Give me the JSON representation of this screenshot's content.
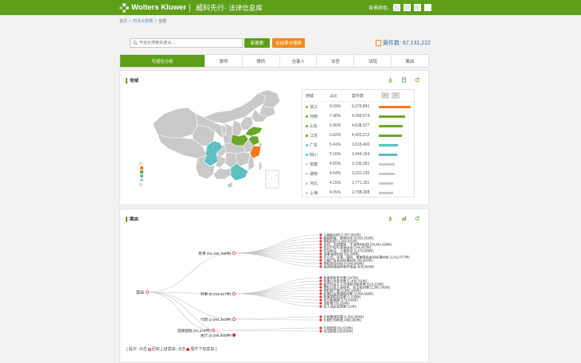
{
  "header": {
    "brand": "Wolters Kluwer",
    "brand_cn": "威科先行",
    "product": "· 法律信息库",
    "skin_label": "背景颜色:"
  },
  "breadcrumb": {
    "home": "首页",
    "section": "司法大数据",
    "current": "全部"
  },
  "search": {
    "placeholder": "可视化搜索关键词.....",
    "new_search": "新搜索",
    "search_within": "在结果中搜索"
  },
  "case_total": {
    "label": "案件数:",
    "value": "67,131,222"
  },
  "tabs": [
    {
      "label": "可视化分析",
      "active": true
    },
    {
      "label": "律师"
    },
    {
      "label": "律所"
    },
    {
      "label": "当事人"
    },
    {
      "label": "法官"
    },
    {
      "label": "法院"
    },
    {
      "label": "案由"
    }
  ],
  "region_panel": {
    "title": "地域",
    "legend": {
      "high": "高",
      "low": "低"
    },
    "colors": {
      "orange": "#f47a20",
      "green": "#6aa82b",
      "teal": "#5cc0c0",
      "grey": "#c9c9c9",
      "dark_grey": "#9a9a9a"
    },
    "table": {
      "headers": [
        "地域",
        "占比",
        "案件数"
      ],
      "prev": "<",
      "next": ">",
      "rows": [
        {
          "region": "浙江",
          "share": "9.09%",
          "count": "6,070,841",
          "ratio": 1.0,
          "color": "#f47a20"
        },
        {
          "region": "河南",
          "share": "7.48%",
          "count": "4,999,574",
          "ratio": 0.82,
          "color": "#6aa82b"
        },
        {
          "region": "山东",
          "share": "6.95%",
          "count": "4,638,977",
          "ratio": 0.76,
          "color": "#6aa82b"
        },
        {
          "region": "江苏",
          "share": "6.62%",
          "count": "4,420,212",
          "ratio": 0.73,
          "color": "#6aa82b"
        },
        {
          "region": "广东",
          "share": "5.41%",
          "count": "3,615,400",
          "ratio": 0.6,
          "color": "#5cc0c0"
        },
        {
          "region": "四川",
          "share": "5.16%",
          "count": "3,444,164",
          "ratio": 0.57,
          "color": "#5cc0c0"
        },
        {
          "region": "安徽",
          "share": "4.65%",
          "count": "3,105,391",
          "ratio": 0.51,
          "color": "#c9c9c9"
        },
        {
          "region": "湖南",
          "share": "4.64%",
          "count": "3,101,135",
          "ratio": 0.51,
          "color": "#c9c9c9"
        },
        {
          "region": "河北",
          "share": "4.15%",
          "count": "2,771,161",
          "ratio": 0.46,
          "color": "#c9c9c9"
        },
        {
          "region": "上海",
          "share": "4.05%",
          "count": "2,708,338",
          "ratio": 0.45,
          "color": "#c9c9c9"
        }
      ]
    }
  },
  "cause_panel": {
    "title": "案由",
    "hint_pre": "[ 提示: 点击",
    "hint_mid": "回到上级案由, 点击",
    "hint_post": "展开下级案由 ]",
    "root": "案由",
    "branches": [
      {
        "label": "民事 (54,185,769件)",
        "leaves": [
          "人格权纠纷 (1,057,993件)",
          "婚姻家庭、继承纠纷 (5,553,152件)",
          "物权纠纷 (1,608,025件)",
          "合同、无因管理、不当得利纠纷 (34,340,298件)",
          "知识产权与竞争纠纷 (744,457件)",
          "劳动争议、人事争议 (2,470,856件)",
          "海事海商纠纷 (56,396件)",
          "与公司、证券、保险、票据等有关的民事纠纷 (1,012,077件)",
          "与破产有关的民事纠纷 (58,055件)",
          "侵权责任纠纷 (4,588,009件)",
          "适用特殊程序案件案由 (905,666件)"
        ]
      },
      {
        "label": "刑事 (8,219,317件)",
        "leaves": [
          "危害国家安全罪 (247件)",
          "危害公共安全罪 (1,409,761件)",
          "破坏社会主义市场经济秩序罪 (513,203件)",
          "侵犯公民人身权利、民主权利罪 (1,380,705件)",
          "侵犯财产罪 (2,005,448件)",
          "妨害社会管理秩序罪 (2,904,966件)",
          "危害国防利益罪 (1,536件)",
          "贪污贿赂罪 (173,440件)",
          "渎职罪 (30,264件)",
          "军人违反职责罪 (12件)"
        ]
      },
      {
        "label": "行政 (2,094,383件)",
        "leaves": [
          "行政管理范围 (1,602,350件)",
          "行政行为种类 (490,083件)"
        ]
      },
      {
        "label": "国家赔偿 (91,229件)",
        "leaves": [
          "行政赔偿 (62,533件)",
          "司法赔偿 (28,656件)"
        ]
      },
      {
        "label": "执行 (5,088,945件)",
        "leaves": []
      }
    ]
  }
}
